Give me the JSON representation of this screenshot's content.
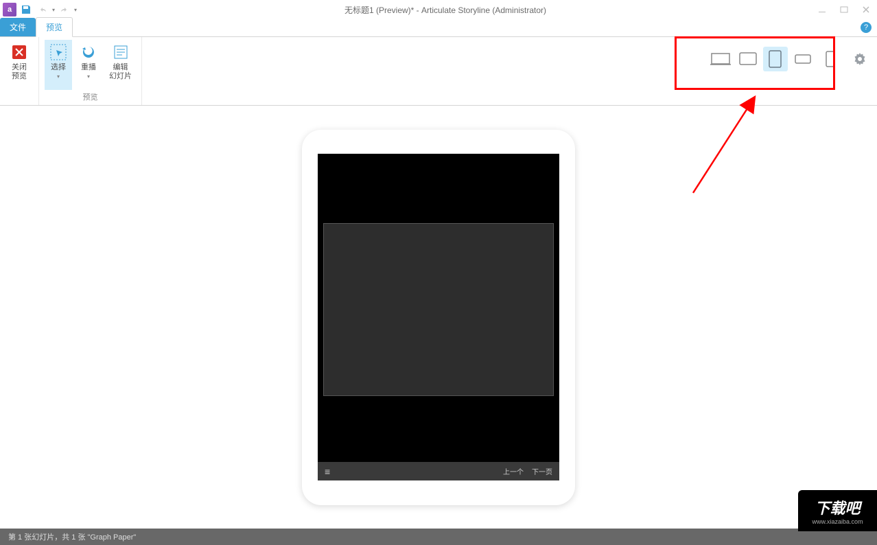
{
  "titlebar": {
    "title": "无标题1 (Preview)* -  Articulate Storyline (Administrator)"
  },
  "tabs": {
    "file": "文件",
    "preview": "预览"
  },
  "ribbon": {
    "close_preview": "关闭\n预览",
    "select": "选择",
    "replay": "重播",
    "edit_slide": "编辑\n幻灯片",
    "group_preview": "预览"
  },
  "devices": {
    "desktop": "desktop",
    "tablet_landscape": "tablet-landscape",
    "tablet_portrait": "tablet-portrait",
    "phone_landscape": "phone-landscape",
    "phone_portrait": "phone-portrait"
  },
  "player": {
    "prev": "上一个",
    "next": "下一页"
  },
  "statusbar": {
    "text": "第 1 张幻灯片，共 1 张    \"Graph Paper\""
  },
  "watermark": {
    "main": "下载吧",
    "sub": "www.xiazaiba.com"
  }
}
